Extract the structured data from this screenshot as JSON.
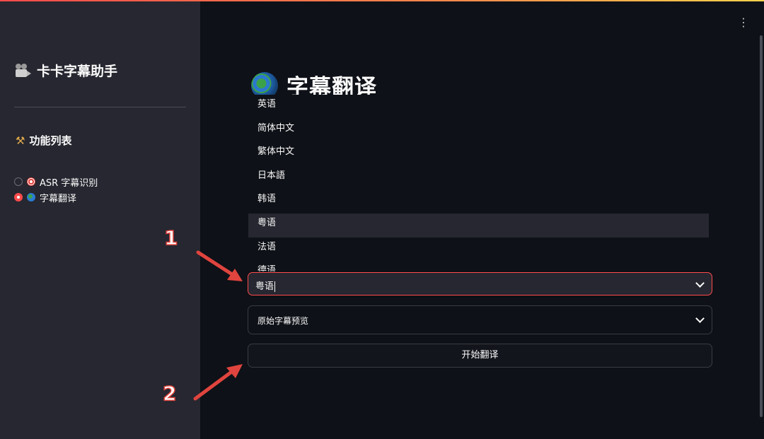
{
  "app": {
    "brand_title": "卡卡字幕助手",
    "brand_icon": "movie-camera-icon",
    "accent_color": "#ff4b4b"
  },
  "sidebar": {
    "section_title": "功能列表",
    "section_icon": "hammer-wrench-icon",
    "items": [
      {
        "label": "ASR 字幕识别",
        "icon": "target-icon",
        "selected": false
      },
      {
        "label": "字幕翻译",
        "icon": "globe-icon",
        "selected": true
      }
    ]
  },
  "main": {
    "page_title": "字幕翻译",
    "page_icon": "globe-icon",
    "language_options": [
      "英语",
      "简体中文",
      "繁体中文",
      "日本語",
      "韩语",
      "粤语",
      "法语",
      "德语"
    ],
    "highlighted_option": "粤语",
    "language_select_value": "粤语",
    "preview_expander_label": "原始字幕预览",
    "start_button_label": "开始翻译"
  },
  "annotations": {
    "step1": "1",
    "step2": "2",
    "color": "#e0443e"
  }
}
